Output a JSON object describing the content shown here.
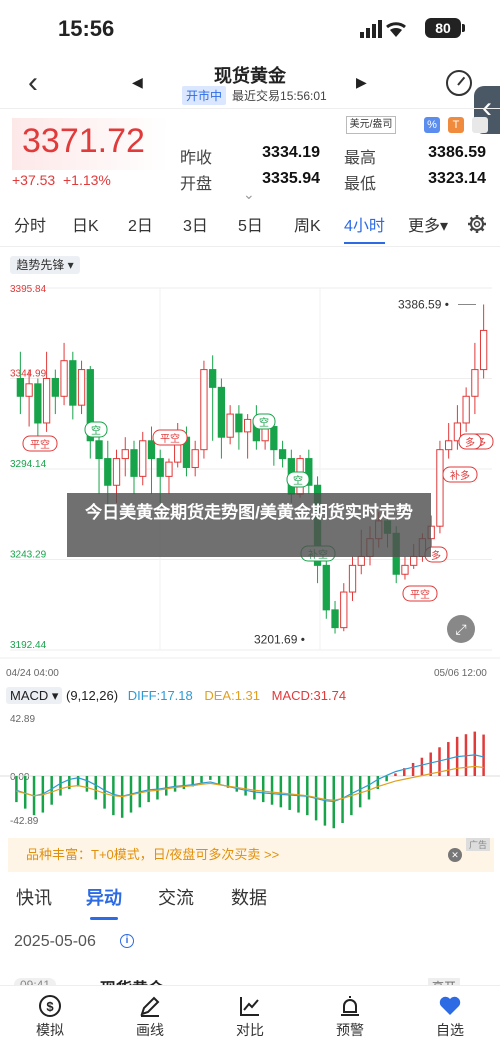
{
  "status": {
    "time": "15:56",
    "battery": "80"
  },
  "header": {
    "title": "现货黄金",
    "market_status": "开市中",
    "last_trade": "最近交易15:56:01"
  },
  "quote": {
    "price": "3371.72",
    "change": "+37.53",
    "change_pct": "+1.13%",
    "prev_close_label": "昨收",
    "prev_close": "3334.19",
    "open_label": "开盘",
    "open": "3335.94",
    "high_label": "最高",
    "high": "3386.59",
    "low_label": "最低",
    "low": "3323.14",
    "unit": "美元/盎司"
  },
  "tabs": [
    "分时",
    "日K",
    "2日",
    "3日",
    "5日",
    "周K",
    "4小时",
    "更多"
  ],
  "active_tab": "4小时",
  "chart": {
    "indicator": "趋势先锋",
    "y_labels": [
      "3395.84",
      "3345.00",
      "3294.14",
      "3243.29",
      "3192.44"
    ],
    "y_labels_shown": [
      "3395.84",
      "3344.99",
      "3294.14",
      "3243.29",
      "3192.44"
    ],
    "max_label": "3386.59",
    "min_label": "3201.69",
    "x_start": "04/24 04:00",
    "x_end": "05/06 12:00",
    "signals": [
      {
        "t": "空",
        "kind": "green"
      },
      {
        "t": "平空",
        "kind": "red"
      },
      {
        "t": "平空",
        "kind": "red"
      },
      {
        "t": "空",
        "kind": "green"
      },
      {
        "t": "空",
        "kind": "green"
      },
      {
        "t": "补空",
        "kind": "green"
      },
      {
        "t": "平空",
        "kind": "red"
      },
      {
        "t": "多",
        "kind": "red"
      },
      {
        "t": "补多",
        "kind": "red"
      },
      {
        "t": "补多",
        "kind": "red"
      },
      {
        "t": "多",
        "kind": "red"
      }
    ],
    "colors": {
      "up": "#e03a3a",
      "down": "#17a34a"
    }
  },
  "overlay_text": "今日美黄金期货走势图/美黄金期货实时走势",
  "macd": {
    "label": "MACD",
    "params": "(9,12,26)",
    "diff": "DIFF:17.18",
    "dea": "DEA:1.31",
    "macd": "MACD:31.74",
    "top": "42.89",
    "zero": "0.00",
    "bottom": "-42.89"
  },
  "promo": {
    "text": "品种丰富：T+0模式，日/夜盘可多次买卖 >>",
    "tag": "广告"
  },
  "news_tabs": [
    "快讯",
    "异动",
    "交流",
    "数据"
  ],
  "news_active": "异动",
  "news_date": "2025-05-06",
  "news_peek": {
    "time": "09:41",
    "title": "现货黄金",
    "tag": "高开"
  },
  "bottom_nav": [
    {
      "label": "模拟",
      "icon": "dollar-icon"
    },
    {
      "label": "画线",
      "icon": "pen-icon"
    },
    {
      "label": "对比",
      "icon": "chart-compare-icon"
    },
    {
      "label": "预警",
      "icon": "alarm-icon"
    },
    {
      "label": "自选",
      "icon": "heart-icon"
    }
  ],
  "chart_data": {
    "type": "candlestick",
    "ylim": [
      3192.44,
      3395.84
    ],
    "max": 3386.59,
    "min": 3201.69,
    "x_range": [
      "04/24 04:00",
      "05/06 12:00"
    ],
    "candles": [
      [
        3345,
        3335,
        3360,
        3325
      ],
      [
        3335,
        3342,
        3350,
        3318
      ],
      [
        3342,
        3320,
        3345,
        3310
      ],
      [
        3320,
        3345,
        3360,
        3315
      ],
      [
        3345,
        3335,
        3350,
        3325
      ],
      [
        3335,
        3355,
        3365,
        3330
      ],
      [
        3355,
        3330,
        3360,
        3322
      ],
      [
        3330,
        3350,
        3355,
        3325
      ],
      [
        3350,
        3310,
        3352,
        3300
      ],
      [
        3310,
        3300,
        3318,
        3280
      ],
      [
        3300,
        3285,
        3310,
        3270
      ],
      [
        3285,
        3300,
        3305,
        3275
      ],
      [
        3300,
        3305,
        3312,
        3290
      ],
      [
        3305,
        3290,
        3310,
        3280
      ],
      [
        3290,
        3310,
        3315,
        3285
      ],
      [
        3310,
        3300,
        3318,
        3280
      ],
      [
        3300,
        3290,
        3305,
        3275
      ],
      [
        3290,
        3298,
        3300,
        3280
      ],
      [
        3298,
        3312,
        3320,
        3295
      ],
      [
        3312,
        3295,
        3318,
        3290
      ],
      [
        3295,
        3305,
        3310,
        3290
      ],
      [
        3305,
        3350,
        3355,
        3300
      ],
      [
        3350,
        3340,
        3358,
        3310
      ],
      [
        3340,
        3312,
        3345,
        3300
      ],
      [
        3312,
        3325,
        3330,
        3308
      ],
      [
        3325,
        3315,
        3330,
        3305
      ],
      [
        3315,
        3322,
        3325,
        3300
      ],
      [
        3322,
        3310,
        3330,
        3305
      ],
      [
        3310,
        3318,
        3320,
        3305
      ],
      [
        3318,
        3305,
        3322,
        3296
      ],
      [
        3305,
        3300,
        3310,
        3295
      ],
      [
        3300,
        3280,
        3305,
        3275
      ],
      [
        3280,
        3300,
        3302,
        3278
      ],
      [
        3300,
        3285,
        3305,
        3280
      ],
      [
        3285,
        3240,
        3290,
        3230
      ],
      [
        3240,
        3215,
        3245,
        3210
      ],
      [
        3215,
        3205,
        3220,
        3201.69
      ],
      [
        3205,
        3225,
        3230,
        3203
      ],
      [
        3225,
        3240,
        3245,
        3220
      ],
      [
        3240,
        3245,
        3260,
        3235
      ],
      [
        3245,
        3255,
        3262,
        3240
      ],
      [
        3255,
        3265,
        3270,
        3250
      ],
      [
        3265,
        3258,
        3270,
        3250
      ],
      [
        3258,
        3235,
        3262,
        3230
      ],
      [
        3235,
        3240,
        3245,
        3232
      ],
      [
        3240,
        3245,
        3252,
        3238
      ],
      [
        3245,
        3255,
        3258,
        3242
      ],
      [
        3255,
        3262,
        3268,
        3250
      ],
      [
        3262,
        3305,
        3310,
        3258
      ],
      [
        3305,
        3310,
        3320,
        3300
      ],
      [
        3310,
        3320,
        3330,
        3305
      ],
      [
        3320,
        3335,
        3340,
        3315
      ],
      [
        3335,
        3350,
        3365,
        3325
      ],
      [
        3350,
        3372,
        3386.59,
        3345
      ]
    ],
    "macd_hist": [
      -20,
      -25,
      -30,
      -28,
      -22,
      -15,
      -10,
      -8,
      -12,
      -18,
      -25,
      -30,
      -32,
      -28,
      -24,
      -20,
      -18,
      -15,
      -12,
      -10,
      -8,
      -5,
      -3,
      -6,
      -9,
      -12,
      -15,
      -18,
      -20,
      -22,
      -24,
      -26,
      -28,
      -30,
      -34,
      -38,
      -40,
      -36,
      -30,
      -24,
      -18,
      -10,
      -4,
      2,
      6,
      10,
      14,
      18,
      22,
      26,
      30,
      32,
      34,
      31.74
    ]
  }
}
